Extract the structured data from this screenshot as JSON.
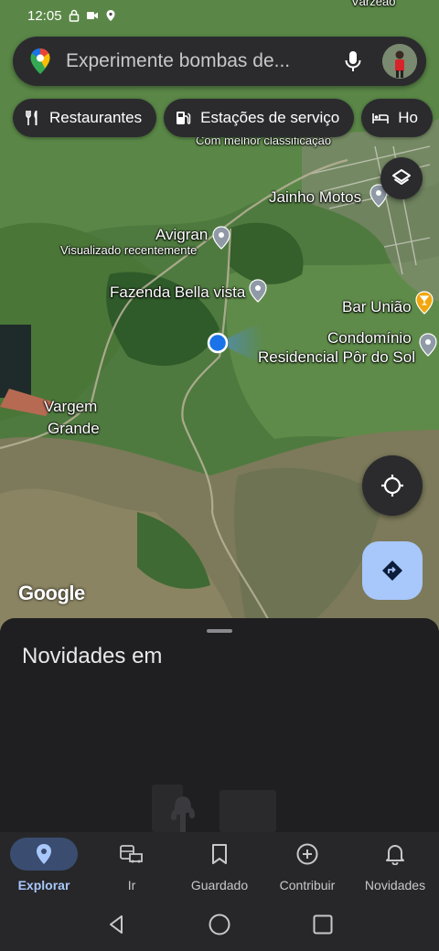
{
  "status": {
    "time": "12:05"
  },
  "search": {
    "placeholder": "Experimente bombas de..."
  },
  "chips": [
    {
      "label": "Restaurantes",
      "icon": "fork-knife-icon"
    },
    {
      "label": "Estações de serviço",
      "icon": "gas-station-icon"
    },
    {
      "label": "Ho",
      "icon": "hotel-bed-icon"
    }
  ],
  "map": {
    "labels": {
      "top_town": "Várzeão",
      "top_rated": "Com melhor classificação",
      "jainho": "Jainho Motos",
      "avigran": "Avigran",
      "avigran_sub": "Visualizado recentemente",
      "fazenda": "Fazenda Bella vista",
      "bar_uniao": "Bar União",
      "condominio_1": "Condomínio",
      "condominio_2": "Residencial Pôr do Sol",
      "vargem_1": "Vargem",
      "vargem_2": "Grande"
    },
    "watermark": "Google",
    "colors": {
      "pin": "#8f9aa6",
      "bar_pin": "#f2a60c",
      "location_dot": "#1a73e8"
    }
  },
  "sheet": {
    "title": "Novidades em"
  },
  "nav": [
    {
      "label": "Explorar",
      "icon": "explore-pin-icon",
      "active": true
    },
    {
      "label": "Ir",
      "icon": "commute-icon",
      "active": false
    },
    {
      "label": "Guardado",
      "icon": "bookmark-icon",
      "active": false
    },
    {
      "label": "Contribuir",
      "icon": "add-circle-icon",
      "active": false
    },
    {
      "label": "Novidades",
      "icon": "bell-icon",
      "active": false
    }
  ],
  "colors": {
    "accent": "#a8c7fa",
    "surface": "#2b2b2e",
    "sheet": "#1f1f22"
  }
}
